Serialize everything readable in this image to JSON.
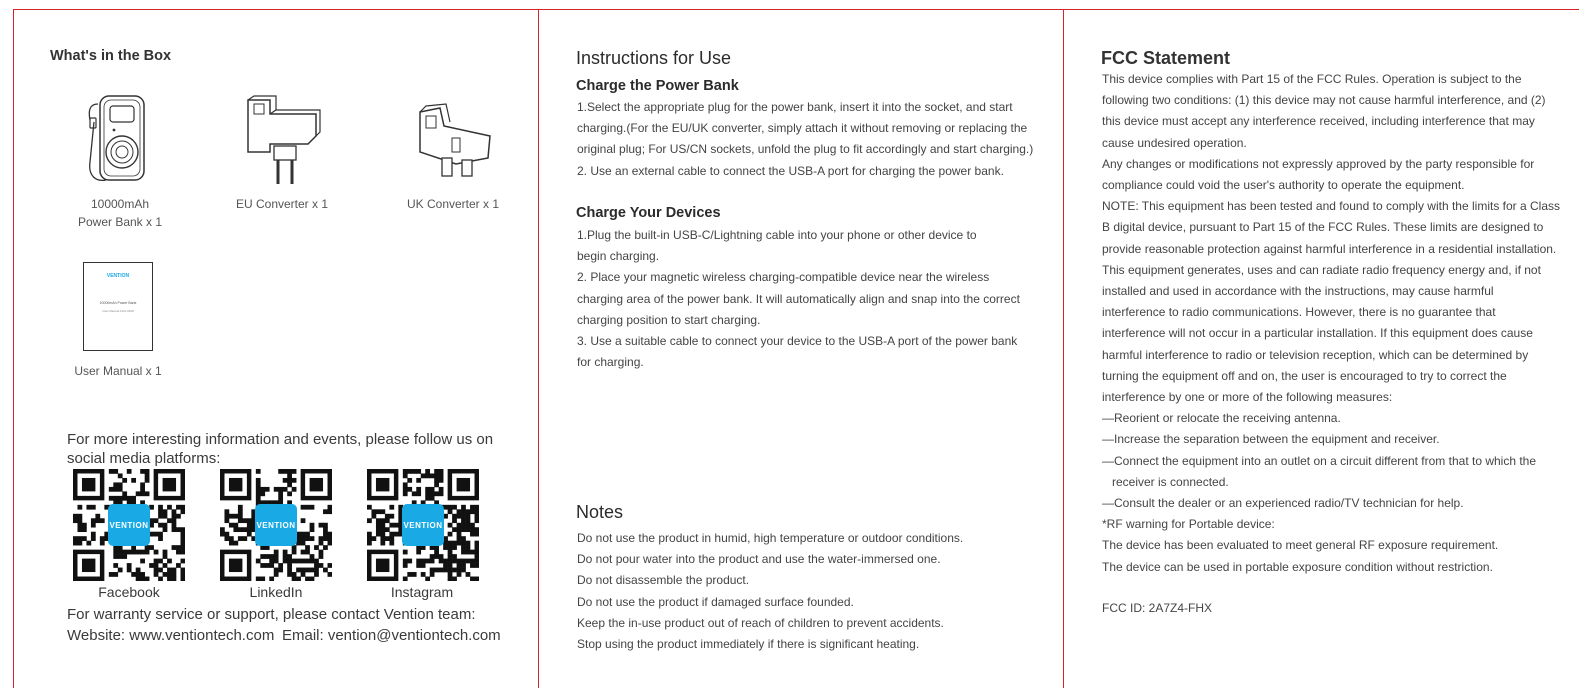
{
  "box": {
    "title": "What's in the Box",
    "items": [
      {
        "line1": "10000mAh",
        "line2": "Power Bank x 1",
        "icon": "power-bank-icon"
      },
      {
        "line1": "EU Converter x 1",
        "icon": "eu-plug-icon"
      },
      {
        "line1": "UK Converter x 1",
        "icon": "uk-plug-icon"
      },
      {
        "line1": "User Manual x 1",
        "icon": "manual-icon"
      }
    ],
    "manual_brand": "VENTION",
    "manual_title": "10000mAh Power Bank",
    "manual_sub": "User Manual FHX-0108"
  },
  "social": {
    "intro": "For more interesting information and events, please follow us on social media platforms:",
    "badge": "VENTION",
    "platforms": [
      "Facebook",
      "LinkedIn",
      "Instagram"
    ],
    "support": "For warranty service or support, please contact Vention team:",
    "website": "Website: www.ventiontech.com",
    "email": "Email: vention@ventiontech.com"
  },
  "instructions": {
    "title": "Instructions for Use",
    "charge_bank": {
      "title": "Charge the Power Bank",
      "lines": [
        "1.Select the appropriate plug for the power bank, insert it into the socket, and start",
        "charging.(For the EU/UK converter, simply attach it without removing or replacing the",
        "original plug; For US/CN sockets, unfold the plug to fit accordingly and start charging.)",
        "2. Use an external cable to connect the USB-A port for charging the power bank."
      ]
    },
    "charge_devices": {
      "title": "Charge Your Devices",
      "lines": [
        "1.Plug the built-in USB-C/Lightning cable into your phone or other device to",
        "begin charging.",
        "2. Place your magnetic wireless charging-compatible device near the wireless",
        "charging area of the power bank. It will automatically align and snap into the correct",
        "charging position to start charging.",
        "3. Use a suitable cable to connect your device to the USB-A port of the power bank",
        "for charging."
      ]
    }
  },
  "notes": {
    "title": "Notes",
    "lines": [
      "Do not use the product in humid, high temperature or outdoor conditions.",
      "Do not pour water into the product and use the water-immersed one.",
      "Do not disassemble the product.",
      "Do not use the product if damaged surface founded.",
      "Keep the in-use product out of reach of children to prevent accidents.",
      "Stop using the product immediately if there is significant heating."
    ]
  },
  "fcc": {
    "title": "FCC Statement",
    "lines": [
      "This device complies with Part 15 of the FCC Rules. Operation is subject to the",
      "following two conditions: (1) this device may not cause harmful interference, and (2)",
      "this device must accept any interference received, including interference that may",
      "cause undesired operation.",
      "Any changes or modifications not expressly approved by the party responsible for",
      "compliance could void the user's authority to operate the equipment.",
      "NOTE: This equipment has been tested and found to comply with the limits for a Class",
      "B digital device, pursuant to Part 15 of the FCC Rules. These limits are designed to",
      "provide reasonable protection against harmful interference in a residential installation.",
      "This equipment generates, uses and can radiate radio frequency energy and, if not",
      "installed and used in accordance with the instructions, may cause harmful",
      "interference to radio communications. However, there is no guarantee that",
      "interference will not occur in a particular installation. If this equipment does cause",
      "harmful interference to radio or television reception, which can be determined by",
      "turning the equipment off and on, the user is encouraged to try to correct the",
      "interference by one or more of the following measures:",
      "—Reorient or relocate the receiving antenna.",
      "—Increase the separation between the equipment and receiver.",
      "—Connect the equipment into an outlet on a circuit different from that to which the",
      "receiver is connected.",
      "—Consult the dealer or an experienced radio/TV technician for help.",
      "*RF warning for Portable device:",
      "The device has been evaluated to meet general RF exposure requirement.",
      "The device can be used in portable exposure condition without restriction."
    ],
    "fcc_id": "FCC ID: 2A7Z4-FHX"
  },
  "colors": {
    "frame": "#d8222a",
    "brand": "#19a9e5"
  }
}
